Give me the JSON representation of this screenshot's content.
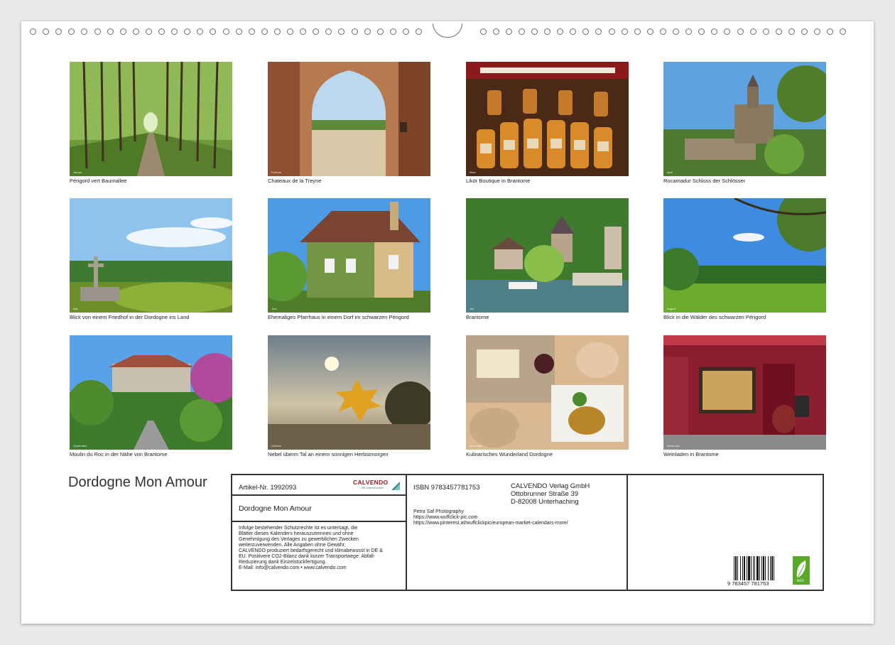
{
  "photos": [
    {
      "caption": "Périgord vert Baumallee",
      "month": "Januar"
    },
    {
      "caption": "Chateaux de la Treyne",
      "month": "Februar"
    },
    {
      "caption": "Likör Boutique in Brantome",
      "month": "März"
    },
    {
      "caption": "Rocamadur Schloss der Schlösser",
      "month": "April"
    },
    {
      "caption": "Blick von einem Friedhof in der Dordogne ins Land",
      "month": "Mai"
    },
    {
      "caption": "Ehemaliges Pfarrhaus in einem Dorf im schwarzen Périgord",
      "month": "Juni"
    },
    {
      "caption": "Brantome",
      "month": "Juli"
    },
    {
      "caption": "Blick in die Wälder des schwarzen Périgord",
      "month": "August"
    },
    {
      "caption": "Moulin du Roc in der Nähe von Brantome",
      "month": "September"
    },
    {
      "caption": "Nebel überm Tal an einem sonnigen Herbstmorgen",
      "month": "Oktober"
    },
    {
      "caption": "Kulinarisches Wunderland Dordogne",
      "month": "November"
    },
    {
      "caption": "Weinladen in Brantome",
      "month": "Dezember"
    }
  ],
  "title": "Dordogne Mon Amour",
  "info": {
    "article": "Artikel-Nr. 1992093",
    "logo_text": "CALVENDO",
    "logo_sub": "Ihre Kalendermarke",
    "calendar_title": "Dordogne Mon Amour",
    "legal": [
      "Infolge bestehender Schutzrechte ist es untersagt, die",
      "Blätter dieses Kalenders herauszutrennen und ohne",
      "Genehmigung des Verlages zu gewerblichen Zwecken",
      "weiterzuverwenden. Alle Angaben ohne Gewähr.",
      "CALVENDO produziert bedarfsgerecht und klimabewusst in DE &",
      "EU. Positivere CO2-Bilanz dank kurzer Transportwege. Abfall-",
      "Reduzierung dank Einzelstückfertigung.",
      "E-Mail: info@calvendo.com • www.calvendo.com"
    ],
    "isbn": "ISBN 9783457781753",
    "publisher": [
      "CALVENDO Verlag GmbH",
      "Ottobrunner Straße 39",
      "D-82008 Unterhaching"
    ],
    "author": [
      "Petra Saf Photography",
      "https://www.wuffclick-pic.com",
      "https://www.pinterest.at/wuffclickpic/european-market-calendars-more/"
    ],
    "barcode_number": "9 783457 781753",
    "eco_label": "eco"
  }
}
